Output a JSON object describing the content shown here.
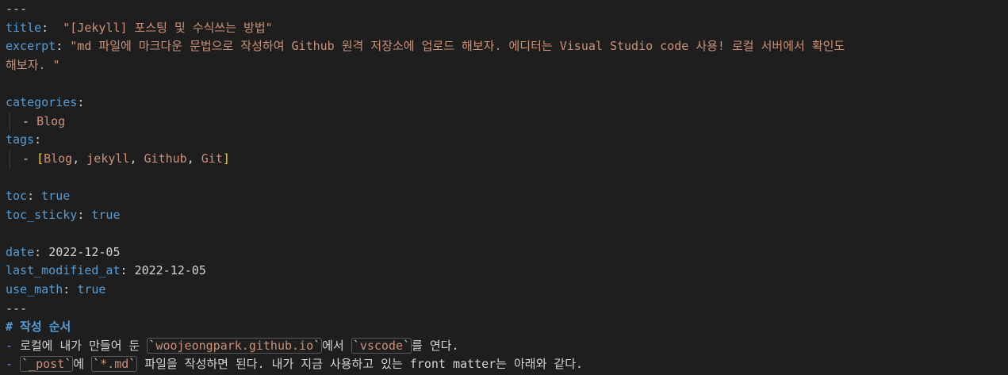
{
  "editor": {
    "fm_open": "---",
    "title_key": "title",
    "title_value": " \"[Jekyll] 포스팅 및 수식쓰는 방법\"",
    "excerpt_key": "excerpt",
    "excerpt_value_1": "\"md 파일에 마크다운 문법으로 작성하여 Github 원격 저장소에 업로드 해보자. 에디터는 Visual Studio code 사용! 로컬 서버에서 확인도",
    "excerpt_value_2": "해보자. \"",
    "categories_key": "categories",
    "categories_item": "Blog",
    "tags_key": "tags",
    "tags_items": [
      "Blog",
      "jekyll",
      "Github",
      "Git"
    ],
    "toc_key": "toc",
    "toc_value": "true",
    "toc_sticky_key": "toc_sticky",
    "toc_sticky_value": "true",
    "date_key": "date",
    "date_value": "2022-12-05",
    "last_modified_key": "last_modified_at",
    "last_modified_value": "2022-12-05",
    "use_math_key": "use_math",
    "use_math_value": "true",
    "fm_close": "---",
    "heading": "# 작성 순서",
    "list1_text_a": "로컬에 내가 만들어 둔 ",
    "list1_code_a": "woojeongpark.github.io",
    "list1_text_b": "에서 ",
    "list1_code_b": "vscode",
    "list1_text_c": "를 연다.",
    "list2_code_a": "_post",
    "list2_text_a": "에 ",
    "list2_code_b": "*.md",
    "list2_text_b": " 파일을 작성하면 된다. 내가 지금 사용하고 있는 front matter는 아래와 같다."
  }
}
